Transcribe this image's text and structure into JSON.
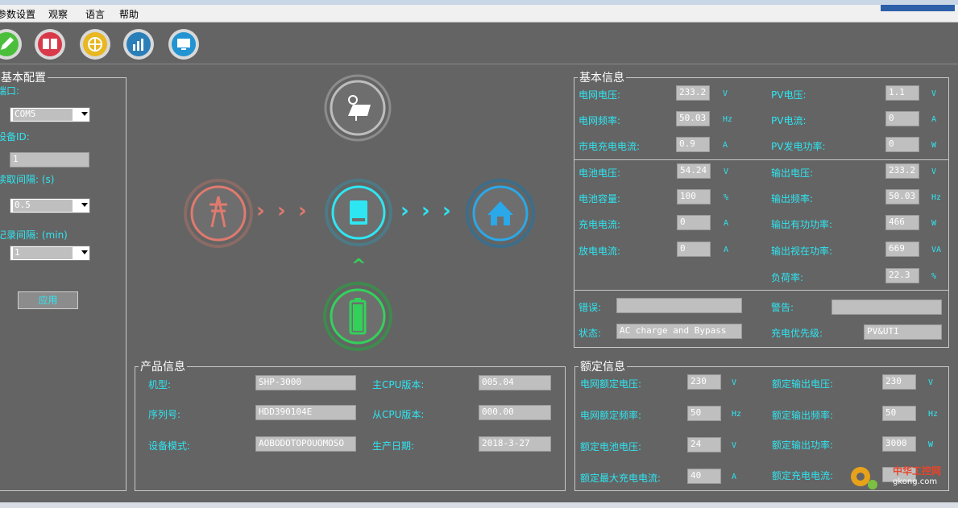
{
  "menu": {
    "items": [
      "参数设置",
      "观察",
      "语言",
      "帮助"
    ]
  },
  "toolbar": {
    "icons": [
      "pencil-icon",
      "book-icon",
      "globe-icon",
      "chart-icon",
      "monitor-icon"
    ]
  },
  "basic_config": {
    "title": "基本配置",
    "port_label": "端口:",
    "port_value": "COM5",
    "device_id_label": "设备ID:",
    "device_id_value": "1",
    "read_interval_label": "读取间隔: (s)",
    "read_interval_value": "0.5",
    "log_interval_label": "记录间隔: (min)",
    "log_interval_value": "1",
    "apply_label": "应用"
  },
  "basic_info": {
    "title": "基本信息",
    "grid_voltage": {
      "label": "电网电压:",
      "value": "233.2",
      "unit": "V"
    },
    "grid_freq": {
      "label": "电网频率:",
      "value": "50.03",
      "unit": "Hz"
    },
    "mains_charge_current": {
      "label": "市电充电电流:",
      "value": "0.9",
      "unit": "A"
    },
    "pv_voltage": {
      "label": "PV电压:",
      "value": "1.1",
      "unit": "V"
    },
    "pv_current": {
      "label": "PV电流:",
      "value": "0",
      "unit": "A"
    },
    "pv_power": {
      "label": "PV发电功率:",
      "value": "0",
      "unit": "W"
    },
    "battery_voltage": {
      "label": "电池电压:",
      "value": "54.24",
      "unit": "V"
    },
    "battery_capacity": {
      "label": "电池容量:",
      "value": "100",
      "unit": "%"
    },
    "charge_current": {
      "label": "充电电流:",
      "value": "0",
      "unit": "A"
    },
    "discharge_current": {
      "label": "放电电流:",
      "value": "0",
      "unit": "A"
    },
    "output_voltage": {
      "label": "输出电压:",
      "value": "233.2",
      "unit": "V"
    },
    "output_freq": {
      "label": "输出频率:",
      "value": "50.03",
      "unit": "Hz"
    },
    "output_active_power": {
      "label": "输出有功功率:",
      "value": "466",
      "unit": "W"
    },
    "output_apparent_power": {
      "label": "输出视在功率:",
      "value": "669",
      "unit": "VA"
    },
    "load_rate": {
      "label": "负荷率:",
      "value": "22.3",
      "unit": "%"
    },
    "error_label": "错误:",
    "error_value": "",
    "warning_label": "警告:",
    "warning_value": "",
    "status_label": "状态:",
    "status_value": "AC charge and Bypass",
    "charge_priority_label": "充电优先级:",
    "charge_priority_value": "PV&UTI"
  },
  "product_info": {
    "title": "产品信息",
    "model_label": "机型:",
    "model_value": "SHP-3000",
    "main_cpu_label": "主CPU版本:",
    "main_cpu_value": "005.04",
    "serial_label": "序列号:",
    "serial_value": "HDD390104E",
    "slave_cpu_label": "从CPU版本:",
    "slave_cpu_value": "000.00",
    "device_mode_label": "设备模式:",
    "device_mode_value": "AOBODOTOPOUOMOSO",
    "prod_date_label": "生产日期:",
    "prod_date_value": "2018-3-27"
  },
  "rated_info": {
    "title": "额定信息",
    "rated_grid_voltage": {
      "label": "电网额定电压:",
      "value": "230",
      "unit": "V"
    },
    "rated_grid_freq": {
      "label": "电网额定频率:",
      "value": "50",
      "unit": "Hz"
    },
    "rated_battery_voltage": {
      "label": "额定电池电压:",
      "value": "24",
      "unit": "V"
    },
    "rated_max_charge_current": {
      "label": "额定最大充电电流:",
      "value": "40",
      "unit": "A"
    },
    "rated_output_voltage": {
      "label": "额定输出电压:",
      "value": "230",
      "unit": "V"
    },
    "rated_output_freq": {
      "label": "额定输出频率:",
      "value": "50",
      "unit": "Hz"
    },
    "rated_output_power": {
      "label": "额定输出功率:",
      "value": "3000",
      "unit": "W"
    },
    "rated_charge_current": {
      "label": "额定充电电流:",
      "value": "",
      "unit": ""
    }
  },
  "watermark": {
    "site": "中华工控网",
    "url": "gkong.com"
  },
  "colors": {
    "cyan": "#2ee6f2",
    "grid_red": "#e07a6e",
    "load_blue": "#2aa8e8",
    "battery_green": "#33d15a",
    "panel_bg": "#646464"
  }
}
